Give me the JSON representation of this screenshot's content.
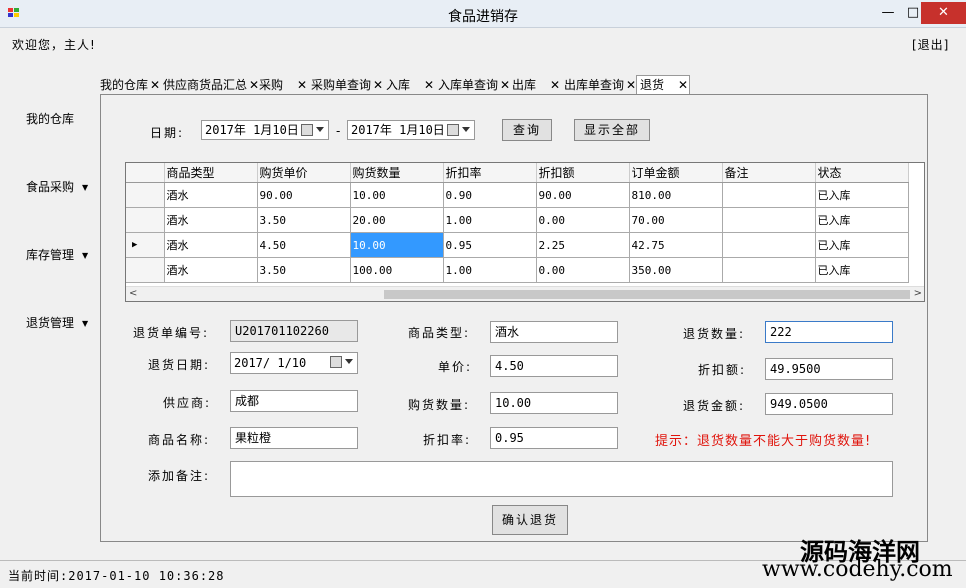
{
  "window": {
    "title": "食品进销存",
    "min": "—",
    "max": "□",
    "close": "✕"
  },
  "header": {
    "welcome": "欢迎您，主人!",
    "logout": "[退出]"
  },
  "nav": [
    {
      "label": "我的仓库",
      "dropdown": false
    },
    {
      "label": "食品采购",
      "dropdown": true
    },
    {
      "label": "库存管理",
      "dropdown": true
    },
    {
      "label": "退货管理",
      "dropdown": true
    }
  ],
  "tabs": [
    "我的仓库",
    "供应商货品汇总",
    "采购",
    "采购单查询",
    "入库",
    "入库单查询",
    "出库",
    "出库单查询",
    "退货"
  ],
  "tab_close": "✕",
  "search": {
    "date_label": "日期:",
    "from": "2017年  1月10日",
    "sep": "-",
    "to": "2017年  1月10日",
    "query_button": "查询",
    "show_all_button": "显示全部"
  },
  "grid": {
    "columns": [
      "商品类型",
      "购货单价",
      "购货数量",
      "折扣率",
      "折扣额",
      "订单金额",
      "备注",
      "状态"
    ],
    "rows": [
      [
        "酒水",
        "90.00",
        "10.00",
        "0.90",
        "90.00",
        "810.00",
        "",
        "已入库"
      ],
      [
        "酒水",
        "3.50",
        "20.00",
        "1.00",
        "0.00",
        "70.00",
        "",
        "已入库"
      ],
      [
        "酒水",
        "4.50",
        "10.00",
        "0.95",
        "2.25",
        "42.75",
        "",
        "已入库"
      ],
      [
        "酒水",
        "3.50",
        "100.00",
        "1.00",
        "0.00",
        "350.00",
        "",
        "已入库"
      ]
    ],
    "current_row_marker": "▶",
    "scroll_left": "<",
    "scroll_right": ">"
  },
  "form": {
    "return_no_label": "退货单编号:",
    "return_no": "U201701102260",
    "return_date_label": "退货日期:",
    "return_date": "2017/ 1/10",
    "supplier_label": "供应商:",
    "supplier": "成都",
    "product_name_label": "商品名称:",
    "product_name": "果粒橙",
    "type_label": "商品类型:",
    "type": "酒水",
    "price_label": "单价:",
    "price": "4.50",
    "purchase_qty_label": "购货数量:",
    "purchase_qty": "10.00",
    "discount_rate_label": "折扣率:",
    "discount_rate": "0.95",
    "return_qty_label": "退货数量:",
    "return_qty": "222",
    "discount_amt_label": "折扣额:",
    "discount_amt": "49.9500",
    "return_amt_label": "退货金额:",
    "return_amt": "949.0500",
    "note_label": "添加备注:",
    "note": "",
    "hint": "提示：退货数量不能大于购货数量!",
    "confirm_button": "确认退货"
  },
  "status": {
    "time": "当前时间:2017-01-10 10:36:28"
  },
  "watermark": {
    "big": "源码海洋网",
    "small": "www.codehy.com"
  }
}
